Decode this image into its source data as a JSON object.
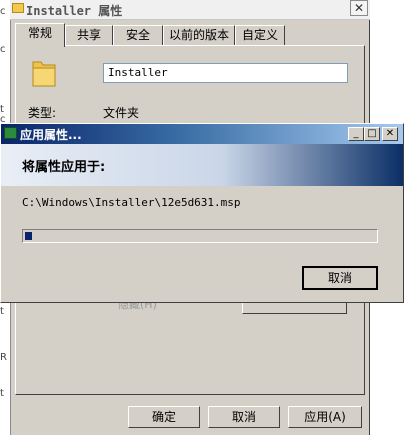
{
  "background_window": {
    "title": "Installer 属性",
    "tabs": [
      "常规",
      "共享",
      "安全",
      "以前的版本",
      "自定义"
    ],
    "folder_name_value": "Installer",
    "type_label": "类型:",
    "type_value": "文件夹",
    "obscured_text": "隐藏(H)",
    "buttons": {
      "ok": "确定",
      "cancel": "取消",
      "apply": "应用(A)"
    }
  },
  "desktop_strip_chars": [
    "c",
    "c",
    "t",
    "c",
    "t",
    "t",
    "R",
    "t"
  ],
  "progress_dialog": {
    "title": "应用属性...",
    "header": "将属性应用于:",
    "path": "C:\\Windows\\Installer\\12e5d631.msp",
    "progress_fraction": 0.02,
    "cancel_label": "取消"
  },
  "colors": {
    "title_bar_start": "#0a246a",
    "progress_fill": "#0a246a",
    "face": "#d4d0c8"
  }
}
